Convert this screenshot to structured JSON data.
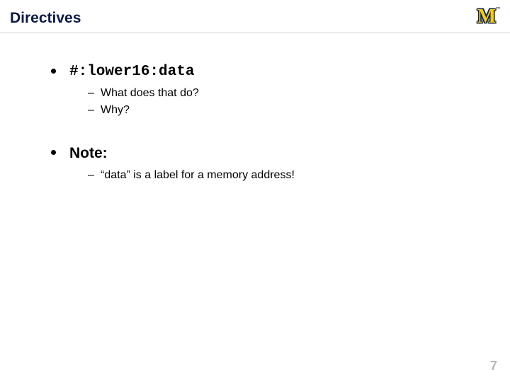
{
  "title": "Directives",
  "logo_text": "M",
  "logo_tm": "™",
  "bullets": [
    {
      "text": "#:lower16:data",
      "mono": true,
      "sub": [
        "What does that do?",
        "Why?"
      ]
    },
    {
      "text": "Note:",
      "mono": false,
      "sub": [
        "“data” is a label for a memory address!"
      ]
    }
  ],
  "page_number": "7"
}
